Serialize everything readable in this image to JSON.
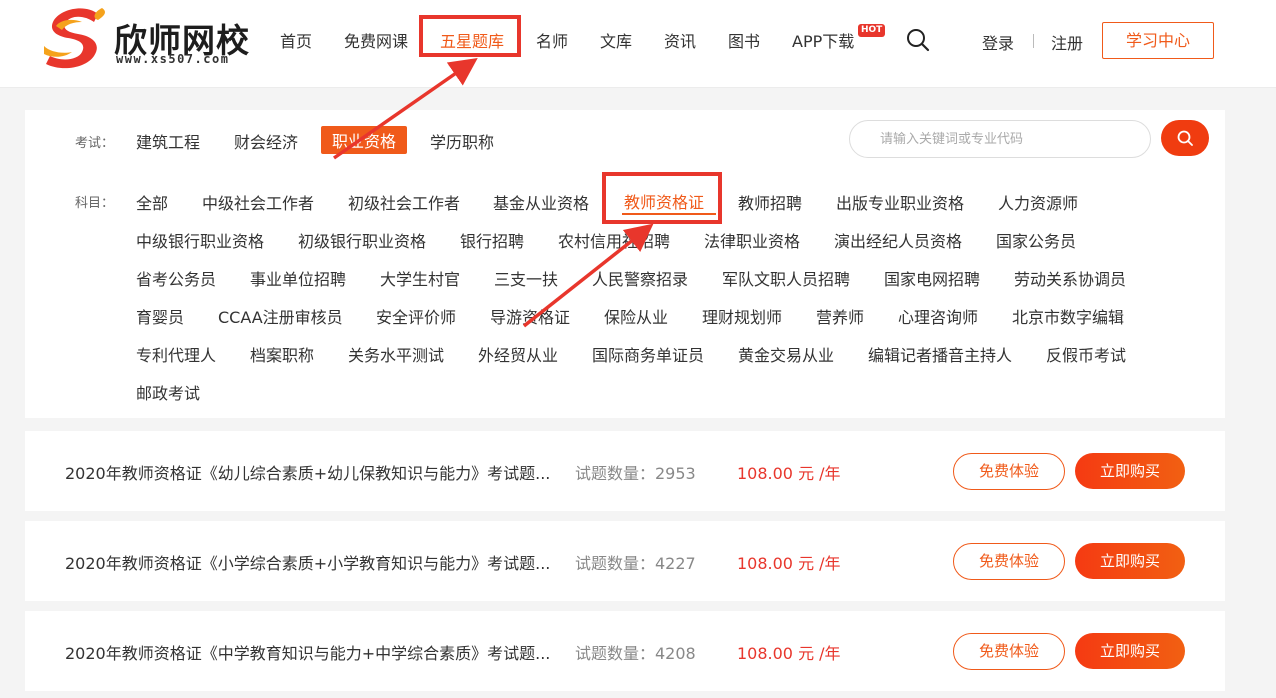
{
  "header": {
    "logo_text": "欣师网校",
    "logo_url": "www.xs507.com",
    "nav": [
      {
        "label": "首页"
      },
      {
        "label": "免费网课"
      },
      {
        "label": "五星题库"
      },
      {
        "label": "名师"
      },
      {
        "label": "文库"
      },
      {
        "label": "资讯"
      },
      {
        "label": "图书"
      },
      {
        "label": "APP下载"
      }
    ],
    "hot_badge": "HOT",
    "login": "登录",
    "register": "注册",
    "learn_center": "学习中心"
  },
  "filter": {
    "exam_label": "考试：",
    "exam_items": [
      "建筑工程",
      "财会经济",
      "职业资格",
      "学历职称"
    ],
    "search_placeholder": "请输入关键词或专业代码",
    "subject_label": "科目：",
    "subject_rows": [
      [
        "全部",
        "中级社会工作者",
        "初级社会工作者",
        "基金从业资格",
        "教师资格证",
        "教师招聘",
        "出版专业职业资格",
        "人力资源师"
      ],
      [
        "中级银行职业资格",
        "初级银行职业资格",
        "银行招聘",
        "农村信用社招聘",
        "法律职业资格",
        "演出经纪人员资格",
        "国家公务员"
      ],
      [
        "省考公务员",
        "事业单位招聘",
        "大学生村官",
        "三支一扶",
        "人民警察招录",
        "军队文职人员招聘",
        "国家电网招聘",
        "劳动关系协调员"
      ],
      [
        "育婴员",
        "CCAA注册审核员",
        "安全评价师",
        "导游资格证",
        "保险从业",
        "理财规划师",
        "营养师",
        "心理咨询师",
        "北京市数字编辑"
      ],
      [
        "专利代理人",
        "档案职称",
        "关务水平测试",
        "外经贸从业",
        "国际商务单证员",
        "黄金交易从业",
        "编辑记者播音主持人",
        "反假币考试"
      ],
      [
        "邮政考试"
      ]
    ]
  },
  "courses": [
    {
      "title": "2020年教师资格证《幼儿综合素质+幼儿保教知识与能力》考试题...",
      "count": "试题数量：2953",
      "price": "108.00 元 /年",
      "free_label": "免费体验",
      "buy_label": "立即购买"
    },
    {
      "title": "2020年教师资格证《小学综合素质+小学教育知识与能力》考试题...",
      "count": "试题数量：4227",
      "price": "108.00 元 /年",
      "free_label": "免费体验",
      "buy_label": "立即购买"
    },
    {
      "title": "2020年教师资格证《中学教育知识与能力+中学综合素质》考试题...",
      "count": "试题数量：4208",
      "price": "108.00 元 /年",
      "free_label": "免费体验",
      "buy_label": "立即购买"
    }
  ],
  "colors": {
    "accent": "#f05a1a",
    "highlight_box": "#e8362c",
    "price": "#e8362c"
  }
}
